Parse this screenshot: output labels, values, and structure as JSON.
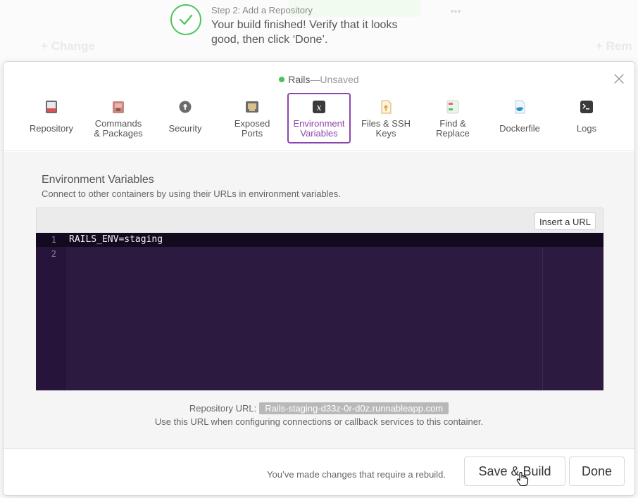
{
  "background": {
    "faded_left": "+ Change",
    "faded_right": "+ Rem"
  },
  "step": {
    "label": "Step 2: Add a Repository",
    "message": "Your build finished! Verify that it looks good, then click ‘Done’.",
    "more": "°°°"
  },
  "modal": {
    "title": {
      "name": "Rails",
      "separator": "—",
      "status": "Unsaved",
      "status_color": "#4cc35a"
    },
    "tabs": [
      {
        "label_line1": "Repository",
        "label_line2": "",
        "icon": "repository-icon"
      },
      {
        "label_line1": "Commands",
        "label_line2": "& Packages",
        "icon": "commands-packages-icon"
      },
      {
        "label_line1": "Security",
        "label_line2": "",
        "icon": "security-icon"
      },
      {
        "label_line1": "Exposed",
        "label_line2": "Ports",
        "icon": "exposed-ports-icon"
      },
      {
        "label_line1": "Environment",
        "label_line2": "Variables",
        "icon": "environment-variables-icon",
        "active": true
      },
      {
        "label_line1": "Files & SSH",
        "label_line2": "Keys",
        "icon": "files-ssh-keys-icon"
      },
      {
        "label_line1": "Find &",
        "label_line2": "Replace",
        "icon": "find-replace-icon"
      },
      {
        "label_line1": "Dockerfile",
        "label_line2": "",
        "icon": "dockerfile-icon"
      },
      {
        "label_line1": "Logs",
        "label_line2": "",
        "icon": "logs-icon"
      }
    ],
    "section": {
      "title": "Environment Variables",
      "description": "Connect to other containers by using their URLs in environment variables."
    },
    "editor": {
      "insert_button": "Insert a URL",
      "lines": [
        {
          "number": "1",
          "text": "RAILS_ENV=staging"
        },
        {
          "number": "2",
          "text": ""
        }
      ]
    },
    "repository_url": {
      "label": "Repository URL:",
      "value": "Rails-staging-d33z-0r-d0z.runnableapp.com",
      "note": "Use this URL when configuring connections or callback services to this container."
    },
    "footer": {
      "note": "You’ve made changes that require a rebuild.",
      "save_build": "Save & Build",
      "done": "Done"
    }
  },
  "colors": {
    "accent": "#8e44ad",
    "success": "#4cc35a",
    "editor_bg": "#2d1a40"
  }
}
